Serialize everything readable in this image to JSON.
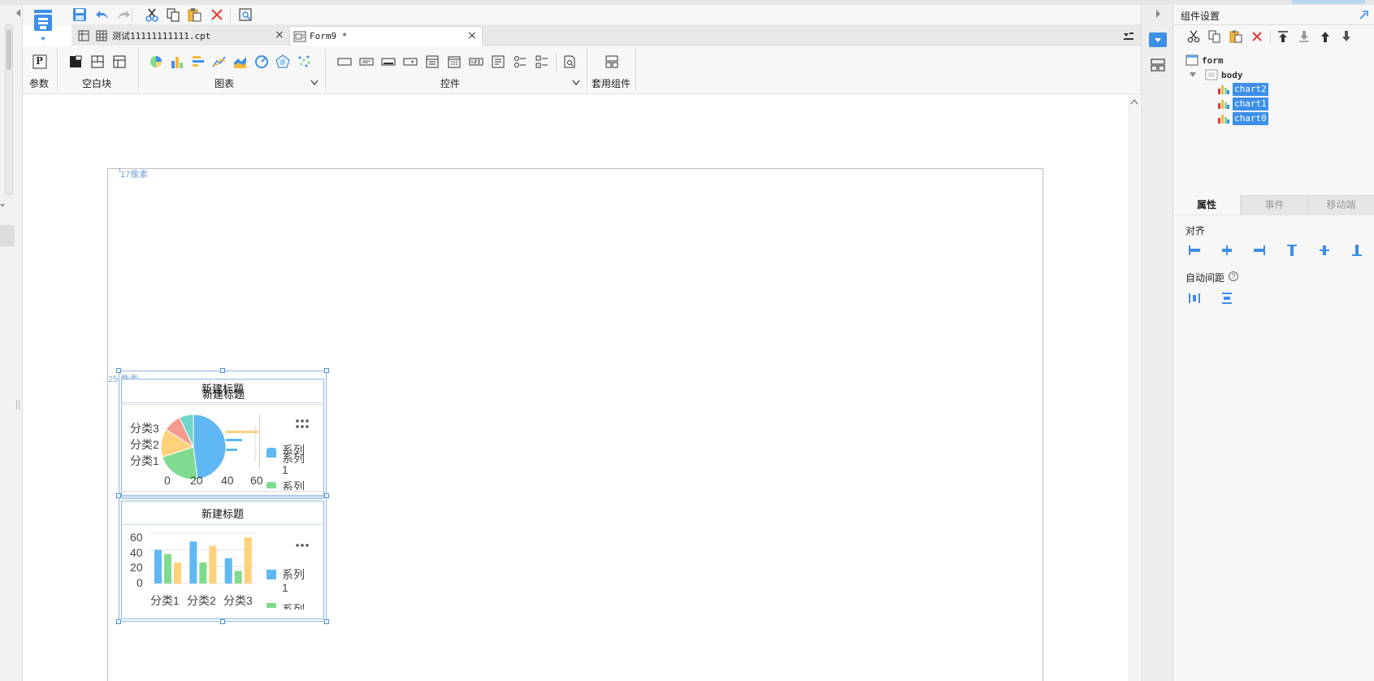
{
  "tabs": [
    {
      "label": "测试11111111111.cpt"
    },
    {
      "label": "Form9 *"
    }
  ],
  "ribbon": {
    "groups": [
      "参数",
      "空白块",
      "图表",
      "控件",
      "套用组件"
    ],
    "param_glyph": "P"
  },
  "canvas": {
    "top_label": "17像素",
    "section_label": "25 像素"
  },
  "widgets": {
    "chart_top": {
      "title": "新建标题",
      "title_overlay": "新建标题",
      "categories": [
        "分类3",
        "分类2",
        "分类1"
      ],
      "x_ticks": [
        "0",
        "20",
        "40",
        "60"
      ],
      "legend": [
        "系列",
        "1",
        "系列"
      ]
    },
    "chart_bottom": {
      "title": "新建标题",
      "y_ticks": [
        "60",
        "40",
        "20",
        "0"
      ],
      "categories": [
        "分类1",
        "分类2",
        "分类3"
      ],
      "legend": [
        "系列",
        "1",
        "系列"
      ]
    }
  },
  "chart_data": {
    "type": "bar",
    "categories": [
      "分类1",
      "分类2",
      "分类3"
    ],
    "ylim": [
      0,
      60
    ],
    "series": [
      {
        "color": "#5fb8f3",
        "values": [
          40,
          50,
          30
        ]
      },
      {
        "color": "#7fdb8f",
        "values": [
          35,
          25,
          15
        ]
      },
      {
        "color": "#fed17a",
        "values": [
          25,
          45,
          55
        ]
      }
    ]
  },
  "pie_data": {
    "type": "pie",
    "slices": [
      {
        "value": 48,
        "color": "#5fb8f3"
      },
      {
        "value": 22,
        "color": "#7fdb8f"
      },
      {
        "value": 14,
        "color": "#fed17a"
      },
      {
        "value": 9,
        "color": "#f59b8d"
      },
      {
        "value": 7,
        "color": "#6fd6c9"
      }
    ]
  },
  "right_panel": {
    "title": "组件设置",
    "tree": {
      "root": "form",
      "body": "body",
      "items": [
        "chart2",
        "chart1",
        "chart0"
      ]
    },
    "prop_tabs": [
      "属性",
      "事件",
      "移动端"
    ],
    "align_label": "对齐",
    "spacing_label": "自动间距",
    "help_glyph": "?"
  },
  "colors": {
    "accent": "#3d8fe8",
    "selection": "#3d8fe8",
    "close_red": "#e53935"
  }
}
